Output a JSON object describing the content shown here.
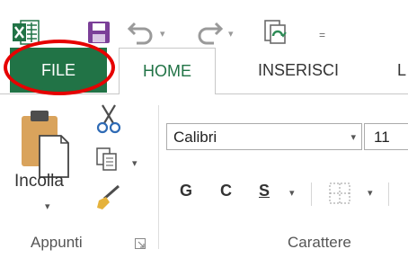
{
  "quick_access": {
    "app_icon": "excel-icon",
    "icons": [
      "save-icon",
      "undo-icon",
      "redo-icon",
      "new-document-icon",
      "customize-toolbar-icon"
    ],
    "dropdown_glyph": "▾",
    "customize_glyph": "="
  },
  "tabs": [
    {
      "label": "FILE",
      "color": "#217346"
    },
    {
      "label": "HOME"
    },
    {
      "label": "INSERISCI"
    },
    {
      "label": "L"
    }
  ],
  "clipboard": {
    "paste_label": "Incolla",
    "group_label": "Appunti",
    "icons": [
      "paste-icon",
      "cut-icon",
      "copy-icon",
      "format-painter-icon",
      "dialog-launcher-icon"
    ]
  },
  "font": {
    "font_name": "Calibri",
    "font_size": "11",
    "bold_label": "G",
    "italic_label": "C",
    "underline_label": "S",
    "group_label": "Carattere",
    "icons": [
      "borders-icon"
    ]
  },
  "colors": {
    "accent": "#217346",
    "highlight_circle": "#e60000"
  }
}
